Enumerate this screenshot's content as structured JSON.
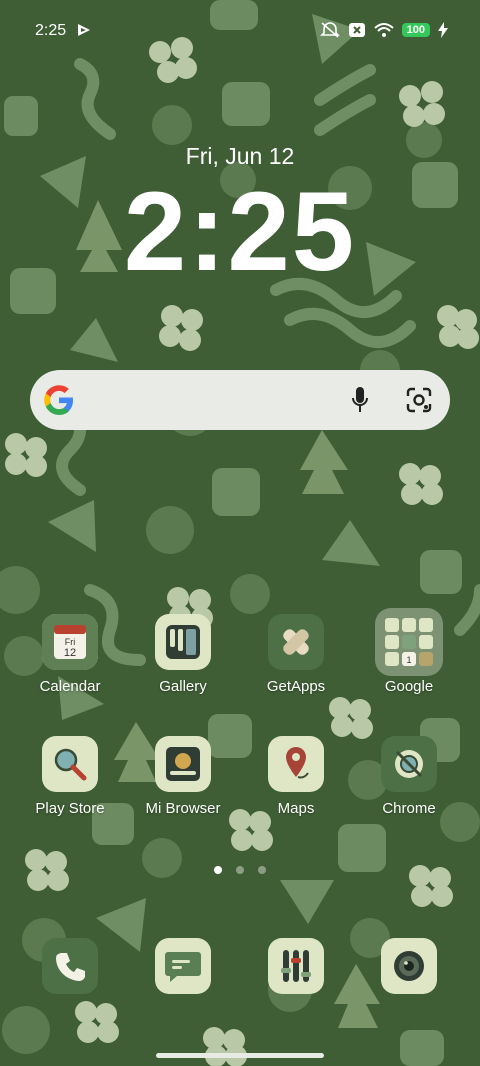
{
  "status_bar": {
    "time": "2:25",
    "battery": "100"
  },
  "lockclock": {
    "date": "Fri, Jun 12",
    "time": "2:25"
  },
  "search_bar": {
    "icons": [
      "google-logo-icon",
      "microphone-icon",
      "google-lens-icon"
    ]
  },
  "apps": [
    {
      "label": "Calendar",
      "icon": "calendar-icon",
      "detail": [
        "Fri",
        "12"
      ]
    },
    {
      "label": "Gallery",
      "icon": "gallery-icon"
    },
    {
      "label": "GetApps",
      "icon": "getapps-icon"
    },
    {
      "label": "Google",
      "icon": "google-folder-icon",
      "detail": [
        "1"
      ]
    },
    {
      "label": "Play Store",
      "icon": "play-store-icon"
    },
    {
      "label": "Mi Browser",
      "icon": "mi-browser-icon"
    },
    {
      "label": "Maps",
      "icon": "maps-icon"
    },
    {
      "label": "Chrome",
      "icon": "chrome-icon"
    }
  ],
  "page_indicator": {
    "pages": 3,
    "current": 1
  },
  "dock": [
    {
      "icon": "phone-icon"
    },
    {
      "icon": "messages-icon"
    },
    {
      "icon": "settings-sliders-icon"
    },
    {
      "icon": "camera-icon"
    }
  ],
  "colors": {
    "wallpaper": "#3f5e35",
    "pattern": "#5e7d52",
    "icon_bg": "#dfe6c6",
    "icon_dark": "#3a4a33",
    "battery": "#34c759"
  }
}
